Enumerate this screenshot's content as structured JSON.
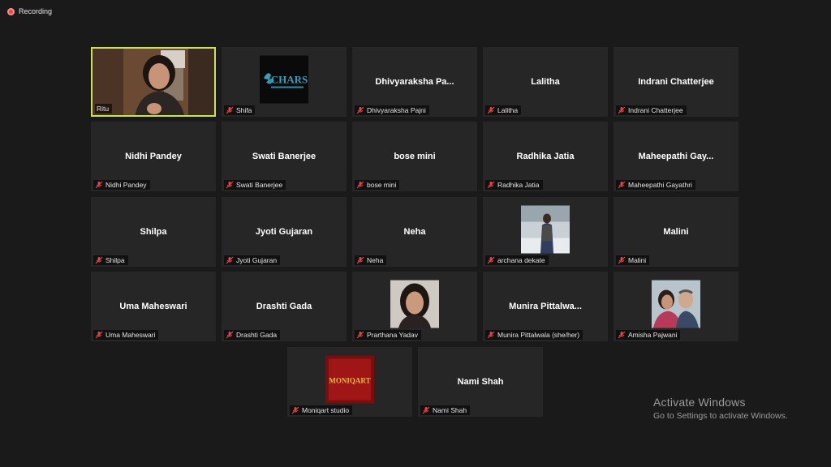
{
  "recording": {
    "label": "Recording"
  },
  "tiles": [
    {
      "id": "ritu",
      "caption": "Ritu",
      "type": "video"
    },
    {
      "id": "shifa",
      "caption": "Shifa",
      "type": "logo",
      "logo_text": "ICHARS"
    },
    {
      "id": "dhivyaraksha",
      "name": "Dhivyaraksha  Pa...",
      "caption": "Dhivyaraksha Pajni"
    },
    {
      "id": "lalitha",
      "name": "Lalitha",
      "caption": "Lalitha"
    },
    {
      "id": "indrani",
      "name": "Indrani Chatterjee",
      "caption": "Indrani Chatterjee"
    },
    {
      "id": "nidhi",
      "name": "Nidhi Pandey",
      "caption": "Nidhi Pandey"
    },
    {
      "id": "swati",
      "name": "Swati Banerjee",
      "caption": "Swati Banerjee"
    },
    {
      "id": "bose",
      "name": "bose mini",
      "caption": "bose mini"
    },
    {
      "id": "radhika",
      "name": "Radhika Jatia",
      "caption": "Radhika Jatia"
    },
    {
      "id": "maheepathi",
      "name": "Maheepathi  Gay...",
      "caption": "Maheepathi Gayathri"
    },
    {
      "id": "shilpa",
      "name": "Shilpa",
      "caption": "Shilpa"
    },
    {
      "id": "jyoti",
      "name": "Jyoti Gujaran",
      "caption": "Jyoti Gujaran"
    },
    {
      "id": "neha",
      "name": "Neha",
      "caption": "Neha"
    },
    {
      "id": "archana",
      "caption": "archana dekate",
      "type": "photo"
    },
    {
      "id": "malini",
      "name": "Malini",
      "caption": "Malini"
    },
    {
      "id": "uma",
      "name": "Uma Maheswari",
      "caption": "Uma Maheswari"
    },
    {
      "id": "drashti",
      "name": "Drashti Gada",
      "caption": "Drashti Gada"
    },
    {
      "id": "prarthana",
      "caption": "Prarthana Yadav",
      "type": "photo"
    },
    {
      "id": "munira",
      "name": "Munira  Pittalwa...",
      "caption": "Munira Pittalwala (she/her)"
    },
    {
      "id": "amisha",
      "caption": "Amisha Pajwani",
      "type": "photo"
    },
    {
      "id": "moniqart",
      "caption": "Moniqart studio",
      "type": "logo",
      "logo_text": "MONIQART"
    },
    {
      "id": "nami",
      "name": "Nami Shah",
      "caption": "Nami Shah"
    }
  ],
  "watermark": {
    "title": "Activate Windows",
    "subtitle": "Go to Settings to activate Windows."
  }
}
